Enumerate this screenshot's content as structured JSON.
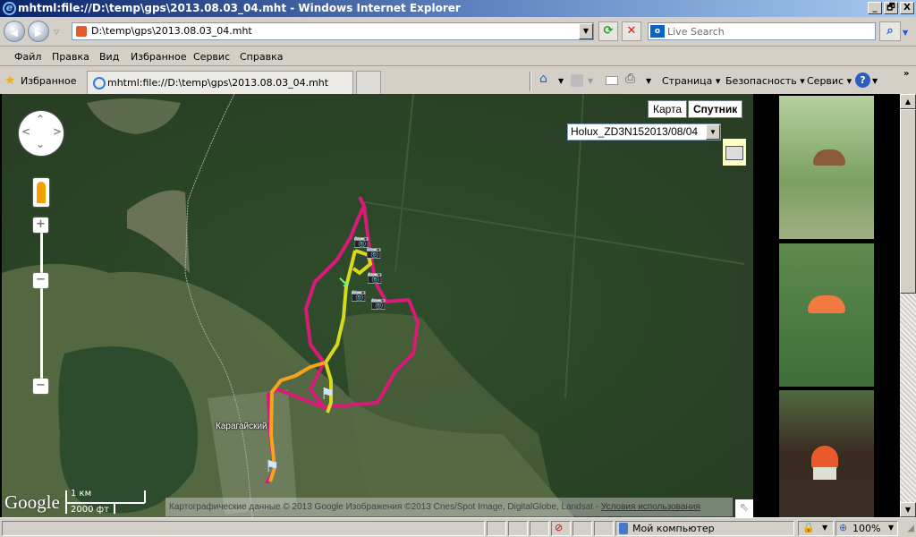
{
  "window": {
    "title": "mhtml:file://D:\\temp\\gps\\2013.08.03_04.mht - Windows Internet Explorer",
    "buttons": {
      "minimize": "_",
      "restore": "🗗",
      "close": "X"
    }
  },
  "navbar": {
    "back_icon": "◀",
    "forward_icon": "▶",
    "address": "D:\\temp\\gps\\2013.08.03_04.mht",
    "refresh_icon": "⟳",
    "stop_icon": "✕",
    "search_placeholder": "Live Search",
    "search_icon": "⌕"
  },
  "menu": {
    "items": [
      "Файл",
      "Правка",
      "Вид",
      "Избранное",
      "Сервис",
      "Справка"
    ]
  },
  "tabbar": {
    "favorites": "Избранное",
    "tab_title": "mhtml:file://D:\\temp\\gps\\2013.08.03_04.mht",
    "tools": {
      "page": "Страница ▾",
      "safety": "Безопасность ▾",
      "service": "Сервис ▾",
      "help": "?"
    }
  },
  "map": {
    "type_buttons": [
      "Карта",
      "Спутник"
    ],
    "selected_type": "Спутник",
    "track_select": "Holux_ZD3N152013/08/04",
    "place_label": "Карагайский",
    "google_logo": "Google",
    "scale": {
      "metric": "1 км",
      "imperial": "2000 фт"
    },
    "copyright": "Картографические данные © 2013 Google Изображения ©2013 Cnes/Spot Image, DigitalGlobe, Landsat - ",
    "terms_link": "Условия использования",
    "zoom_in": "+",
    "zoom_out": "−",
    "track_colors": {
      "magenta": "#d81b78",
      "yellow": "#d8d81c",
      "orange": "#f5a41c"
    }
  },
  "photos": [
    {
      "name": "brown-mushroom-photo"
    },
    {
      "name": "fly-agaric-photo"
    },
    {
      "name": "small-fly-agaric-photo"
    }
  ],
  "statusbar": {
    "zone": "Мой компьютер",
    "zoom": "100%"
  }
}
